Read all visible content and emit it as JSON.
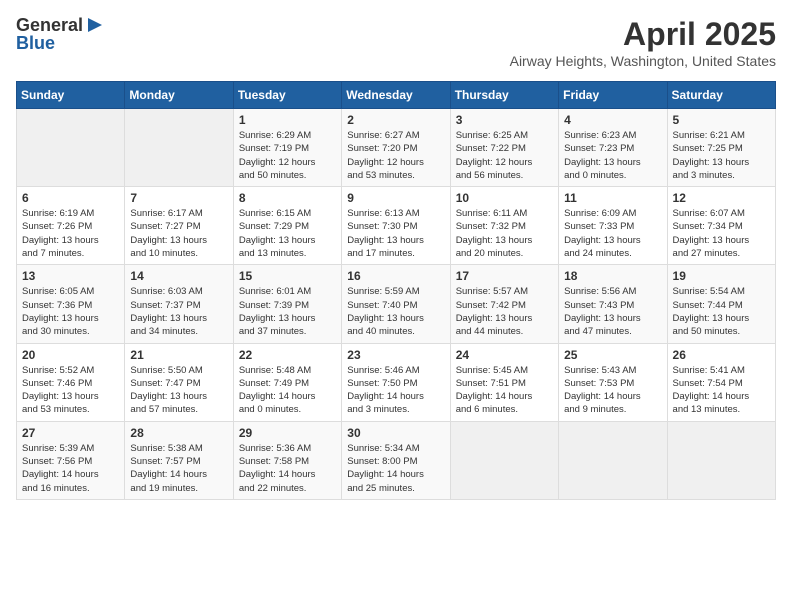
{
  "logo": {
    "general": "General",
    "blue": "Blue"
  },
  "header": {
    "title": "April 2025",
    "subtitle": "Airway Heights, Washington, United States"
  },
  "weekdays": [
    "Sunday",
    "Monday",
    "Tuesday",
    "Wednesday",
    "Thursday",
    "Friday",
    "Saturday"
  ],
  "weeks": [
    [
      {
        "day": "",
        "info": ""
      },
      {
        "day": "",
        "info": ""
      },
      {
        "day": "1",
        "info": "Sunrise: 6:29 AM\nSunset: 7:19 PM\nDaylight: 12 hours\nand 50 minutes."
      },
      {
        "day": "2",
        "info": "Sunrise: 6:27 AM\nSunset: 7:20 PM\nDaylight: 12 hours\nand 53 minutes."
      },
      {
        "day": "3",
        "info": "Sunrise: 6:25 AM\nSunset: 7:22 PM\nDaylight: 12 hours\nand 56 minutes."
      },
      {
        "day": "4",
        "info": "Sunrise: 6:23 AM\nSunset: 7:23 PM\nDaylight: 13 hours\nand 0 minutes."
      },
      {
        "day": "5",
        "info": "Sunrise: 6:21 AM\nSunset: 7:25 PM\nDaylight: 13 hours\nand 3 minutes."
      }
    ],
    [
      {
        "day": "6",
        "info": "Sunrise: 6:19 AM\nSunset: 7:26 PM\nDaylight: 13 hours\nand 7 minutes."
      },
      {
        "day": "7",
        "info": "Sunrise: 6:17 AM\nSunset: 7:27 PM\nDaylight: 13 hours\nand 10 minutes."
      },
      {
        "day": "8",
        "info": "Sunrise: 6:15 AM\nSunset: 7:29 PM\nDaylight: 13 hours\nand 13 minutes."
      },
      {
        "day": "9",
        "info": "Sunrise: 6:13 AM\nSunset: 7:30 PM\nDaylight: 13 hours\nand 17 minutes."
      },
      {
        "day": "10",
        "info": "Sunrise: 6:11 AM\nSunset: 7:32 PM\nDaylight: 13 hours\nand 20 minutes."
      },
      {
        "day": "11",
        "info": "Sunrise: 6:09 AM\nSunset: 7:33 PM\nDaylight: 13 hours\nand 24 minutes."
      },
      {
        "day": "12",
        "info": "Sunrise: 6:07 AM\nSunset: 7:34 PM\nDaylight: 13 hours\nand 27 minutes."
      }
    ],
    [
      {
        "day": "13",
        "info": "Sunrise: 6:05 AM\nSunset: 7:36 PM\nDaylight: 13 hours\nand 30 minutes."
      },
      {
        "day": "14",
        "info": "Sunrise: 6:03 AM\nSunset: 7:37 PM\nDaylight: 13 hours\nand 34 minutes."
      },
      {
        "day": "15",
        "info": "Sunrise: 6:01 AM\nSunset: 7:39 PM\nDaylight: 13 hours\nand 37 minutes."
      },
      {
        "day": "16",
        "info": "Sunrise: 5:59 AM\nSunset: 7:40 PM\nDaylight: 13 hours\nand 40 minutes."
      },
      {
        "day": "17",
        "info": "Sunrise: 5:57 AM\nSunset: 7:42 PM\nDaylight: 13 hours\nand 44 minutes."
      },
      {
        "day": "18",
        "info": "Sunrise: 5:56 AM\nSunset: 7:43 PM\nDaylight: 13 hours\nand 47 minutes."
      },
      {
        "day": "19",
        "info": "Sunrise: 5:54 AM\nSunset: 7:44 PM\nDaylight: 13 hours\nand 50 minutes."
      }
    ],
    [
      {
        "day": "20",
        "info": "Sunrise: 5:52 AM\nSunset: 7:46 PM\nDaylight: 13 hours\nand 53 minutes."
      },
      {
        "day": "21",
        "info": "Sunrise: 5:50 AM\nSunset: 7:47 PM\nDaylight: 13 hours\nand 57 minutes."
      },
      {
        "day": "22",
        "info": "Sunrise: 5:48 AM\nSunset: 7:49 PM\nDaylight: 14 hours\nand 0 minutes."
      },
      {
        "day": "23",
        "info": "Sunrise: 5:46 AM\nSunset: 7:50 PM\nDaylight: 14 hours\nand 3 minutes."
      },
      {
        "day": "24",
        "info": "Sunrise: 5:45 AM\nSunset: 7:51 PM\nDaylight: 14 hours\nand 6 minutes."
      },
      {
        "day": "25",
        "info": "Sunrise: 5:43 AM\nSunset: 7:53 PM\nDaylight: 14 hours\nand 9 minutes."
      },
      {
        "day": "26",
        "info": "Sunrise: 5:41 AM\nSunset: 7:54 PM\nDaylight: 14 hours\nand 13 minutes."
      }
    ],
    [
      {
        "day": "27",
        "info": "Sunrise: 5:39 AM\nSunset: 7:56 PM\nDaylight: 14 hours\nand 16 minutes."
      },
      {
        "day": "28",
        "info": "Sunrise: 5:38 AM\nSunset: 7:57 PM\nDaylight: 14 hours\nand 19 minutes."
      },
      {
        "day": "29",
        "info": "Sunrise: 5:36 AM\nSunset: 7:58 PM\nDaylight: 14 hours\nand 22 minutes."
      },
      {
        "day": "30",
        "info": "Sunrise: 5:34 AM\nSunset: 8:00 PM\nDaylight: 14 hours\nand 25 minutes."
      },
      {
        "day": "",
        "info": ""
      },
      {
        "day": "",
        "info": ""
      },
      {
        "day": "",
        "info": ""
      }
    ]
  ]
}
